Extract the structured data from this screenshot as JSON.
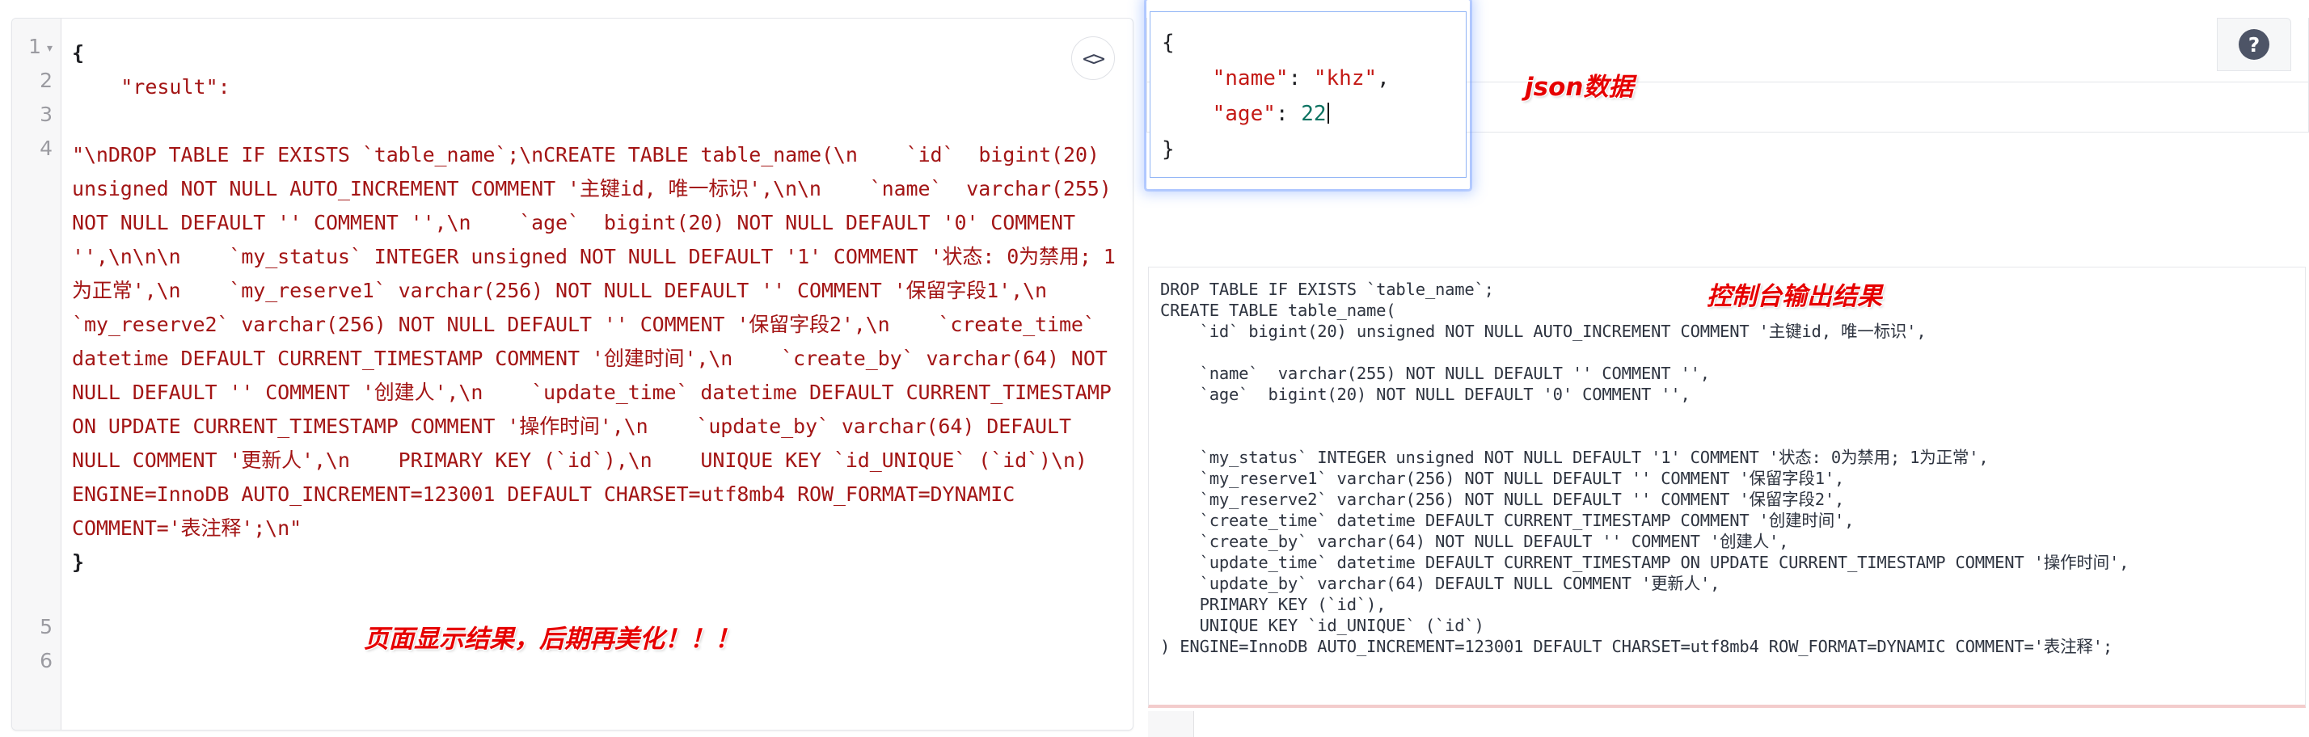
{
  "left_panel": {
    "gutter": [
      {
        "num": "1",
        "fold": "▾"
      },
      {
        "num": "2",
        "fold": ""
      },
      {
        "num": "3",
        "fold": ""
      },
      {
        "num": "4",
        "fold": ""
      },
      {
        "num": "5",
        "fold": ""
      },
      {
        "num": "6",
        "fold": ""
      }
    ],
    "line1": "{",
    "line2_key": "\"result\":",
    "line4_body": "\"\\nDROP TABLE IF EXISTS `table_name`;\\nCREATE TABLE table_name(\\n    `id`  bigint(20) unsigned NOT NULL AUTO_INCREMENT COMMENT '主键id, 唯一标识',\\n\\n    `name`  varchar(255) NOT NULL DEFAULT '' COMMENT '',\\n    `age`  bigint(20) NOT NULL DEFAULT '0' COMMENT '',\\n\\n\\n    `my_status` INTEGER unsigned NOT NULL DEFAULT '1' COMMENT '状态: 0为禁用; 1为正常',\\n    `my_reserve1` varchar(256) NOT NULL DEFAULT '' COMMENT '保留字段1',\\n    `my_reserve2` varchar(256) NOT NULL DEFAULT '' COMMENT '保留字段2',\\n    `create_time` datetime DEFAULT CURRENT_TIMESTAMP COMMENT '创建时间',\\n    `create_by` varchar(64) NOT NULL DEFAULT '' COMMENT '创建人',\\n    `update_time` datetime DEFAULT CURRENT_TIMESTAMP ON UPDATE CURRENT_TIMESTAMP COMMENT '操作时间',\\n    `update_by` varchar(64) DEFAULT NULL COMMENT '更新人',\\n    PRIMARY KEY (`id`),\\n    UNIQUE KEY `id_UNIQUE` (`id`)\\n) ENGINE=InnoDB AUTO_INCREMENT=123001 DEFAULT CHARSET=utf8mb4 ROW_FORMAT=DYNAMIC COMMENT='表注释';\\n\"",
    "line5": "}",
    "code_toggle_label": "<>",
    "annotation": "页面显示结果，后期再美化！！！"
  },
  "json_editor": {
    "line_open": "{",
    "name_key": "\"name\"",
    "name_sep": ": ",
    "name_val": "\"khz\"",
    "name_comma": ",",
    "age_key": "\"age\"",
    "age_sep": ": ",
    "age_val": "22",
    "line_close": "}",
    "annotation": "json数据"
  },
  "console": {
    "annotation": "控制台输出结果",
    "lines": [
      "DROP TABLE IF EXISTS `table_name`;",
      "CREATE TABLE table_name(",
      "    `id` bigint(20) unsigned NOT NULL AUTO_INCREMENT COMMENT '主键id, 唯一标识',",
      "",
      "    `name`  varchar(255) NOT NULL DEFAULT '' COMMENT '',",
      "    `age`  bigint(20) NOT NULL DEFAULT '0' COMMENT '',",
      "",
      "",
      "    `my_status` INTEGER unsigned NOT NULL DEFAULT '1' COMMENT '状态: 0为禁用; 1为正常',",
      "    `my_reserve1` varchar(256) NOT NULL DEFAULT '' COMMENT '保留字段1',",
      "    `my_reserve2` varchar(256) NOT NULL DEFAULT '' COMMENT '保留字段2',",
      "    `create_time` datetime DEFAULT CURRENT_TIMESTAMP COMMENT '创建时间',",
      "    `create_by` varchar(64) NOT NULL DEFAULT '' COMMENT '创建人',",
      "    `update_time` datetime DEFAULT CURRENT_TIMESTAMP ON UPDATE CURRENT_TIMESTAMP COMMENT '操作时间',",
      "    `update_by` varchar(64) DEFAULT NULL COMMENT '更新人',",
      "    PRIMARY KEY (`id`),",
      "    UNIQUE KEY `id_UNIQUE` (`id`)",
      ") ENGINE=InnoDB AUTO_INCREMENT=123001 DEFAULT CHARSET=utf8mb4 ROW_FORMAT=DYNAMIC COMMENT='表注释';"
    ]
  },
  "help": {
    "label": "?"
  }
}
